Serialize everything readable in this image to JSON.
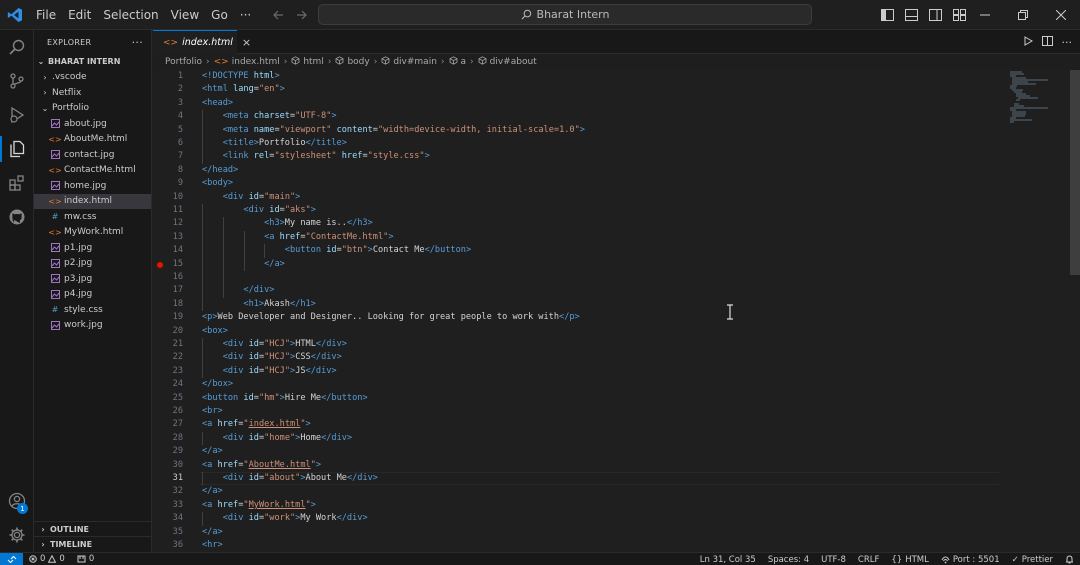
{
  "titlebar": {
    "menu": [
      "File",
      "Edit",
      "Selection",
      "View",
      "Go",
      "···"
    ],
    "search": "Bharat Intern"
  },
  "activitybar": {
    "items": [
      "explorer-icon",
      "search-icon",
      "source-control-icon",
      "run-debug-icon",
      "extensions-icon",
      "github-icon"
    ],
    "account_badge": "1"
  },
  "sidebar": {
    "title": "EXPLORER",
    "more": "···",
    "root": "BHARAT INTERN",
    "items": [
      {
        "label": ".vscode",
        "type": "folder",
        "depth": 1
      },
      {
        "label": "Netflix",
        "type": "folder",
        "depth": 1
      },
      {
        "label": "Portfolio",
        "type": "folder-open",
        "depth": 1
      },
      {
        "label": "about.jpg",
        "type": "image",
        "depth": 2
      },
      {
        "label": "AboutMe.html",
        "type": "html",
        "depth": 2
      },
      {
        "label": "contact.jpg",
        "type": "image",
        "depth": 2
      },
      {
        "label": "ContactMe.html",
        "type": "html",
        "depth": 2
      },
      {
        "label": "home.jpg",
        "type": "image",
        "depth": 2
      },
      {
        "label": "index.html",
        "type": "html",
        "depth": 2,
        "selected": true
      },
      {
        "label": "mw.css",
        "type": "css",
        "depth": 2
      },
      {
        "label": "MyWork.html",
        "type": "html",
        "depth": 2
      },
      {
        "label": "p1.jpg",
        "type": "image",
        "depth": 2
      },
      {
        "label": "p2.jpg",
        "type": "image",
        "depth": 2
      },
      {
        "label": "p3.jpg",
        "type": "image",
        "depth": 2
      },
      {
        "label": "p4.jpg",
        "type": "image",
        "depth": 2
      },
      {
        "label": "style.css",
        "type": "css",
        "depth": 2
      },
      {
        "label": "work.jpg",
        "type": "image",
        "depth": 2
      }
    ],
    "outline": "OUTLINE",
    "timeline": "TIMELINE"
  },
  "tab": {
    "label": "index.html",
    "close": "×"
  },
  "breadcrumb": [
    "Portfolio",
    "index.html",
    "html",
    "body",
    "div#main",
    "a",
    "div#about"
  ],
  "editor": {
    "current_line": 31,
    "breakpoint_line": 15,
    "lines": [
      [
        [
          "t",
          "<!DOCTYPE "
        ],
        [
          "a",
          "html"
        ],
        [
          "t",
          ">"
        ]
      ],
      [
        [
          "t",
          "<html "
        ],
        [
          "a",
          "lang"
        ],
        [
          "x",
          "="
        ],
        [
          "s",
          "\"en\""
        ],
        [
          "t",
          ">"
        ]
      ],
      [
        [
          "t",
          "<head>"
        ]
      ],
      [
        [
          "x",
          "    "
        ],
        [
          "t",
          "<meta "
        ],
        [
          "a",
          "charset"
        ],
        [
          "x",
          "="
        ],
        [
          "s",
          "\"UTF-8\""
        ],
        [
          "t",
          ">"
        ]
      ],
      [
        [
          "x",
          "    "
        ],
        [
          "t",
          "<meta "
        ],
        [
          "a",
          "name"
        ],
        [
          "x",
          "="
        ],
        [
          "s",
          "\"viewport\""
        ],
        [
          "x",
          " "
        ],
        [
          "a",
          "content"
        ],
        [
          "x",
          "="
        ],
        [
          "s",
          "\"width=device-width, initial-scale=1.0\""
        ],
        [
          "t",
          ">"
        ]
      ],
      [
        [
          "x",
          "    "
        ],
        [
          "t",
          "<title>"
        ],
        [
          "x",
          "Portfolio"
        ],
        [
          "t",
          "</title>"
        ]
      ],
      [
        [
          "x",
          "    "
        ],
        [
          "t",
          "<link "
        ],
        [
          "a",
          "rel"
        ],
        [
          "x",
          "="
        ],
        [
          "s",
          "\"stylesheet\""
        ],
        [
          "x",
          " "
        ],
        [
          "a",
          "href"
        ],
        [
          "x",
          "="
        ],
        [
          "s",
          "\"style.css\""
        ],
        [
          "t",
          ">"
        ]
      ],
      [
        [
          "t",
          "</head>"
        ]
      ],
      [
        [
          "t",
          "<body>"
        ]
      ],
      [
        [
          "x",
          "    "
        ],
        [
          "t",
          "<div "
        ],
        [
          "a",
          "id"
        ],
        [
          "x",
          "="
        ],
        [
          "s",
          "\"main\""
        ],
        [
          "t",
          ">"
        ]
      ],
      [
        [
          "x",
          "        "
        ],
        [
          "t",
          "<div "
        ],
        [
          "a",
          "id"
        ],
        [
          "x",
          "="
        ],
        [
          "s",
          "\"aks\""
        ],
        [
          "t",
          ">"
        ]
      ],
      [
        [
          "x",
          "            "
        ],
        [
          "t",
          "<h3>"
        ],
        [
          "x",
          "My name is.."
        ],
        [
          "t",
          "</h3>"
        ]
      ],
      [
        [
          "x",
          "            "
        ],
        [
          "t",
          "<a "
        ],
        [
          "a",
          "href"
        ],
        [
          "x",
          "="
        ],
        [
          "s",
          "\"ContactMe.html\""
        ],
        [
          "t",
          ">"
        ]
      ],
      [
        [
          "x",
          "                "
        ],
        [
          "t",
          "<button "
        ],
        [
          "a",
          "id"
        ],
        [
          "x",
          "="
        ],
        [
          "s",
          "\"btn\""
        ],
        [
          "t",
          ">"
        ],
        [
          "x",
          "Contact Me"
        ],
        [
          "t",
          "</button>"
        ]
      ],
      [
        [
          "x",
          "            "
        ],
        [
          "t",
          "</a>"
        ]
      ],
      [
        [
          "x",
          ""
        ]
      ],
      [
        [
          "x",
          "        "
        ],
        [
          "t",
          "</div>"
        ]
      ],
      [
        [
          "x",
          "        "
        ],
        [
          "t",
          "<h1>"
        ],
        [
          "x",
          "Akash"
        ],
        [
          "t",
          "</h1>"
        ]
      ],
      [
        [
          "t",
          "<p>"
        ],
        [
          "x",
          "Web Developer and Designer.. Looking for great people to work with"
        ],
        [
          "t",
          "</p>"
        ]
      ],
      [
        [
          "t",
          "<box>"
        ]
      ],
      [
        [
          "x",
          "    "
        ],
        [
          "t",
          "<div "
        ],
        [
          "a",
          "id"
        ],
        [
          "x",
          "="
        ],
        [
          "s",
          "\"HCJ\""
        ],
        [
          "t",
          ">"
        ],
        [
          "x",
          "HTML"
        ],
        [
          "t",
          "</div>"
        ]
      ],
      [
        [
          "x",
          "    "
        ],
        [
          "t",
          "<div "
        ],
        [
          "a",
          "id"
        ],
        [
          "x",
          "="
        ],
        [
          "s",
          "\"HCJ\""
        ],
        [
          "t",
          ">"
        ],
        [
          "x",
          "CSS"
        ],
        [
          "t",
          "</div>"
        ]
      ],
      [
        [
          "x",
          "    "
        ],
        [
          "t",
          "<div "
        ],
        [
          "a",
          "id"
        ],
        [
          "x",
          "="
        ],
        [
          "s",
          "\"HCJ\""
        ],
        [
          "t",
          ">"
        ],
        [
          "x",
          "JS"
        ],
        [
          "t",
          "</div>"
        ]
      ],
      [
        [
          "t",
          "</box>"
        ]
      ],
      [
        [
          "t",
          "<button "
        ],
        [
          "a",
          "id"
        ],
        [
          "x",
          "="
        ],
        [
          "s",
          "\"hm\""
        ],
        [
          "t",
          ">"
        ],
        [
          "x",
          "Hire Me"
        ],
        [
          "t",
          "</button>"
        ]
      ],
      [
        [
          "t",
          "<br>"
        ]
      ],
      [
        [
          "t",
          "<a "
        ],
        [
          "a",
          "href"
        ],
        [
          "x",
          "="
        ],
        [
          "s",
          "\""
        ],
        [
          "u",
          "index.html"
        ],
        [
          "s",
          "\""
        ],
        [
          "t",
          ">"
        ]
      ],
      [
        [
          "x",
          "    "
        ],
        [
          "t",
          "<div "
        ],
        [
          "a",
          "id"
        ],
        [
          "x",
          "="
        ],
        [
          "s",
          "\"home\""
        ],
        [
          "t",
          ">"
        ],
        [
          "x",
          "Home"
        ],
        [
          "t",
          "</div>"
        ]
      ],
      [
        [
          "t",
          "</a>"
        ]
      ],
      [
        [
          "t",
          "<a "
        ],
        [
          "a",
          "href"
        ],
        [
          "x",
          "="
        ],
        [
          "s",
          "\""
        ],
        [
          "u",
          "AboutMe.html"
        ],
        [
          "s",
          "\""
        ],
        [
          "t",
          ">"
        ]
      ],
      [
        [
          "x",
          "    "
        ],
        [
          "t",
          "<div "
        ],
        [
          "a",
          "id"
        ],
        [
          "x",
          "="
        ],
        [
          "s",
          "\"about\""
        ],
        [
          "t",
          ">"
        ],
        [
          "x",
          "About Me"
        ],
        [
          "t",
          "</div>"
        ]
      ],
      [
        [
          "t",
          "</a>"
        ]
      ],
      [
        [
          "t",
          "<a "
        ],
        [
          "a",
          "href"
        ],
        [
          "x",
          "="
        ],
        [
          "s",
          "\""
        ],
        [
          "u",
          "MyWork.html"
        ],
        [
          "s",
          "\""
        ],
        [
          "t",
          ">"
        ]
      ],
      [
        [
          "x",
          "    "
        ],
        [
          "t",
          "<div "
        ],
        [
          "a",
          "id"
        ],
        [
          "x",
          "="
        ],
        [
          "s",
          "\"work\""
        ],
        [
          "t",
          ">"
        ],
        [
          "x",
          "My Work"
        ],
        [
          "t",
          "</div>"
        ]
      ],
      [
        [
          "t",
          "</a>"
        ]
      ],
      [
        [
          "t",
          "<hr>"
        ]
      ]
    ]
  },
  "statusbar": {
    "errors": "0",
    "warnings": "0",
    "ports": "0",
    "position": "Ln 31, Col 35",
    "spaces": "Spaces: 4",
    "encoding": "UTF-8",
    "eol": "CRLF",
    "language": "HTML",
    "port": "Port : 5501",
    "prettier": "Prettier"
  },
  "colors": {
    "accent": "#0078d4",
    "tag": "#569cd6",
    "attribute": "#9cdcfe",
    "string": "#ce9178",
    "breakpoint": "#e51400"
  }
}
